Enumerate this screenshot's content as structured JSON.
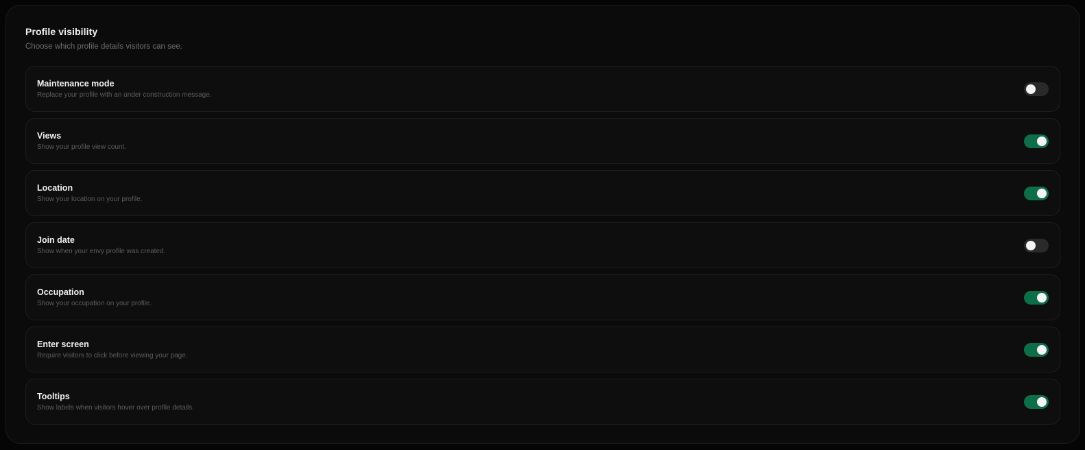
{
  "header": {
    "title": "Profile visibility",
    "subtitle": "Choose which profile details visitors can see."
  },
  "colors": {
    "toggle_on": "#0f6e4a",
    "toggle_off": "#2a2a2a"
  },
  "settings": [
    {
      "title": "Maintenance mode",
      "description": "Replace your profile with an under construction message.",
      "enabled": false
    },
    {
      "title": "Views",
      "description": "Show your profile view count.",
      "enabled": true
    },
    {
      "title": "Location",
      "description": "Show your location on your profile.",
      "enabled": true
    },
    {
      "title": "Join date",
      "description": "Show when your envy profile was created.",
      "enabled": false
    },
    {
      "title": "Occupation",
      "description": "Show your occupation on your profile.",
      "enabled": true
    },
    {
      "title": "Enter screen",
      "description": "Require visitors to click before viewing your page.",
      "enabled": true
    },
    {
      "title": "Tooltips",
      "description": "Show labels when visitors hover over profile details.",
      "enabled": true
    }
  ]
}
